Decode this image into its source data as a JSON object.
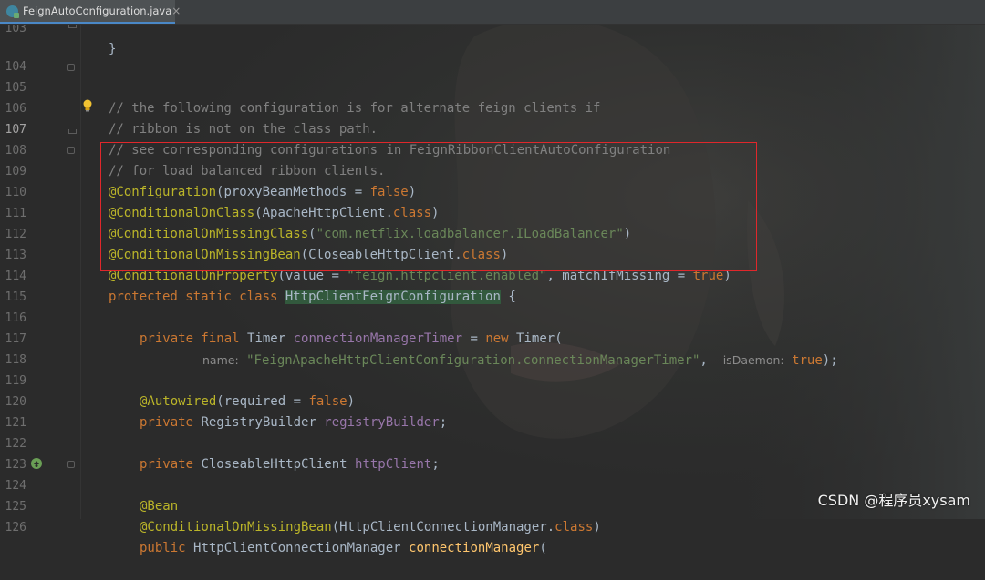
{
  "tab": {
    "filename": "FeignAutoConfiguration.java",
    "close": "×"
  },
  "hints": {
    "name": "name:",
    "is_daemon": "isDaemon:"
  },
  "lines": {
    "l103": {
      "num": "103",
      "code": "}"
    },
    "l104": {
      "num": "104"
    },
    "l105": {
      "num": "105",
      "code": "// the following configuration is for alternate feign clients if"
    },
    "l106": {
      "num": "106",
      "code": "// ribbon is not on the class path."
    },
    "l107": {
      "num": "107",
      "code_a": "// see corresponding configurations",
      "code_b": " in FeignRibbonClientAutoConfiguration"
    },
    "l108": {
      "num": "108",
      "code": "// for load balanced ribbon clients."
    },
    "l109": {
      "num": "109",
      "anno": "@Configuration",
      "p1": "(proxyBeanMethods = ",
      "kw": "false",
      "p2": ")"
    },
    "l110": {
      "num": "110",
      "anno": "@ConditionalOnClass",
      "p1": "(ApacheHttpClient.",
      "kw": "class",
      "p2": ")"
    },
    "l111": {
      "num": "111",
      "anno": "@ConditionalOnMissingClass",
      "p1": "(",
      "str": "\"com.netflix.loadbalancer.ILoadBalancer\"",
      "p2": ")"
    },
    "l112": {
      "num": "112",
      "anno": "@ConditionalOnMissingBean",
      "p1": "(CloseableHttpClient.",
      "kw": "class",
      "p2": ")"
    },
    "l113": {
      "num": "113",
      "anno": "@ConditionalOnProperty",
      "p1": "(value = ",
      "str": "\"feign.httpclient.enabled\"",
      "p2": ", matchIfMissing = ",
      "kw": "true",
      "p3": ")"
    },
    "l114": {
      "num": "114",
      "kw": "protected static class ",
      "cls": "HttpClientFeignConfiguration",
      "p1": " {"
    },
    "l115": {
      "num": "115"
    },
    "l116": {
      "num": "116",
      "kw1": "private final ",
      "t1": "Timer ",
      "field": "connectionManagerTimer",
      "t2": " = ",
      "kw2": "new ",
      "t3": "Timer("
    },
    "l117": {
      "num": "117",
      "str": "\"FeignApacheHttpClientConfiguration.connectionManagerTimer\"",
      "t1": ",  ",
      "kw": "true",
      "t2": ");"
    },
    "l118": {
      "num": "118"
    },
    "l119": {
      "num": "119",
      "anno": "@Autowired",
      "p1": "(required = ",
      "kw": "false",
      "p2": ")"
    },
    "l120": {
      "num": "120",
      "kw": "private ",
      "t1": "RegistryBuilder ",
      "field": "registryBuilder",
      "t2": ";"
    },
    "l121": {
      "num": "121"
    },
    "l122": {
      "num": "122",
      "kw": "private ",
      "t1": "CloseableHttpClient ",
      "field": "httpClient",
      "t2": ";"
    },
    "l123": {
      "num": "123"
    },
    "l124": {
      "num": "124",
      "anno": "@Bean"
    },
    "l125": {
      "num": "125",
      "anno": "@ConditionalOnMissingBean",
      "p1": "(HttpClientConnectionManager.",
      "kw": "class",
      "p2": ")"
    },
    "l126": {
      "num": "126",
      "kw": "public ",
      "t1": "HttpClientConnectionManager ",
      "method": "connectionManager",
      "t2": "("
    }
  },
  "watermark": "CSDN @程序员xysam",
  "colors": {
    "background": "#2b2b2b",
    "comment": "#808080",
    "annotation": "#bbb529",
    "keyword": "#cc7832",
    "string": "#6a8759",
    "field": "#9876aa",
    "method": "#ffc66d",
    "highlight": "#32593d",
    "red_box": "#e0272b"
  }
}
